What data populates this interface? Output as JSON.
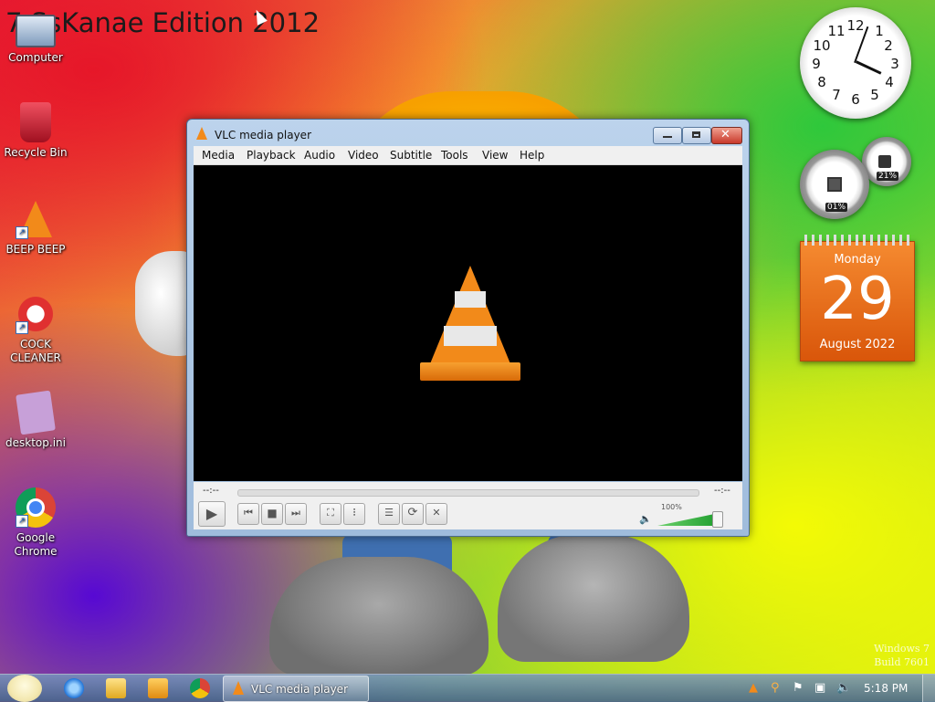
{
  "desktop": {
    "title": "7 SsKanae Edition 2012",
    "icons": [
      {
        "label": "Computer"
      },
      {
        "label": "Recycle Bin"
      },
      {
        "label": "BEEP BEEP"
      },
      {
        "label": "COCK CLEANER"
      },
      {
        "label": "desktop.ini"
      },
      {
        "label": "Google Chrome"
      }
    ],
    "watermark": {
      "line1": "Windows 7",
      "line2": "Build 7601"
    }
  },
  "gadgets": {
    "clock": {
      "numbers": [
        "12",
        "1",
        "2",
        "3",
        "4",
        "5",
        "6",
        "7",
        "8",
        "9",
        "10",
        "11"
      ],
      "time": "5:18"
    },
    "cpu_meter": {
      "cpu": "01%",
      "memory": "21%",
      "cpu_icon": "chip-icon",
      "memory_icon": "memory-icon"
    },
    "calendar": {
      "weekday": "Monday",
      "day": "29",
      "month_year": "August 2022"
    }
  },
  "vlc": {
    "title": "VLC media player",
    "menu": [
      "Media",
      "Playback",
      "Audio",
      "Video",
      "Subtitle",
      "Tools",
      "View",
      "Help"
    ],
    "time_elapsed": "--:--",
    "time_remaining": "--:--",
    "volume": "100%",
    "volume_level": 1.0,
    "accent": "#f28a1a"
  },
  "taskbar": {
    "pinned": [
      "internet-explorer-icon",
      "explorer-folder-icon",
      "media-player-icon",
      "chrome-icon"
    ],
    "active_task": "VLC media player",
    "tray_icons": [
      "vlc-tray-icon",
      "search-tray-icon",
      "action-center-flag-icon",
      "network-icon",
      "volume-icon"
    ],
    "clock": "5:18 PM"
  }
}
